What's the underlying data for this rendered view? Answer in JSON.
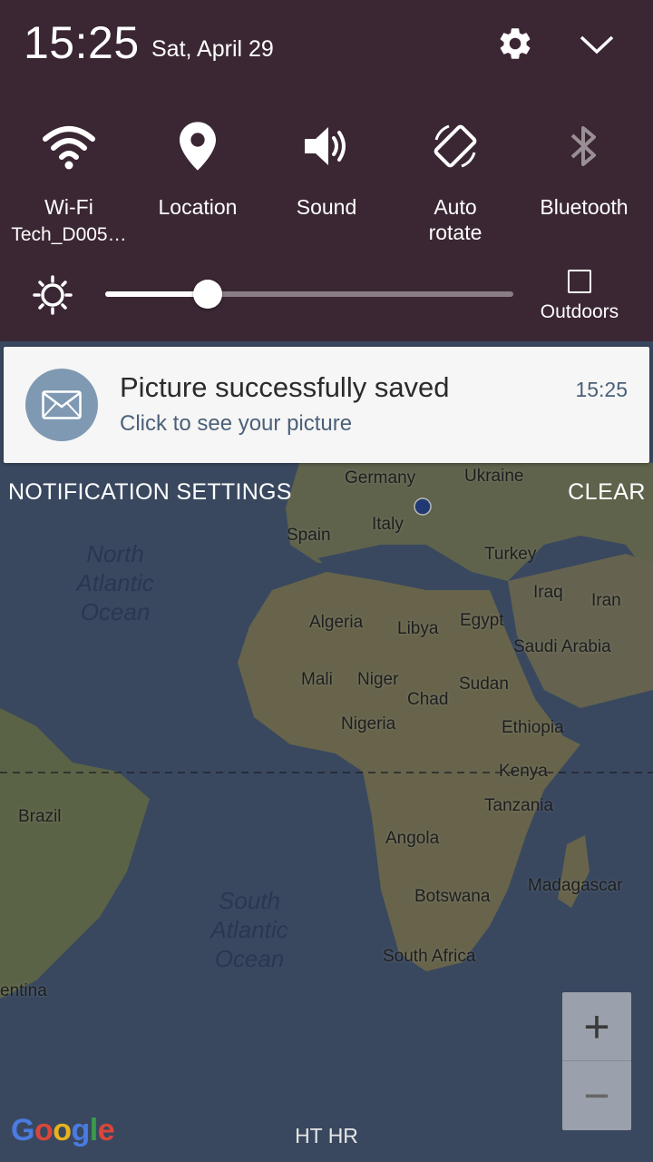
{
  "status": {
    "time": "15:25",
    "date": "Sat, April 29"
  },
  "header_icons": {
    "settings_icon": "gear-icon",
    "collapse_icon": "chevron-down-icon"
  },
  "quick_tiles": [
    {
      "label": "Wi-Fi",
      "sublabel": "Tech_D005…",
      "icon": "wifi-icon",
      "active": true
    },
    {
      "label": "Location",
      "sublabel": "",
      "icon": "location-icon",
      "active": true
    },
    {
      "label": "Sound",
      "sublabel": "",
      "icon": "speaker-icon",
      "active": true
    },
    {
      "label": "Auto\nrotate",
      "sublabel": "",
      "icon": "auto-rotate-icon",
      "active": true
    },
    {
      "label": "Bluetooth",
      "sublabel": "",
      "icon": "bluetooth-icon",
      "active": false
    }
  ],
  "brightness": {
    "level": 0.25,
    "outdoors_label": "Outdoors",
    "outdoors_checked": false
  },
  "notification": {
    "title": "Picture successfully saved",
    "text": "Click to see your picture",
    "time": "15:25",
    "icon": "mail-icon"
  },
  "actions": {
    "notification_settings": "NOTIFICATION SETTINGS",
    "clear": "CLEAR"
  },
  "map": {
    "countries": [
      "Germany",
      "Ukraine",
      "Italy",
      "Spain",
      "Turkey",
      "Iraq",
      "Iran",
      "Algeria",
      "Libya",
      "Egypt",
      "Saudi Arabia",
      "Mali",
      "Niger",
      "Chad",
      "Sudan",
      "Nigeria",
      "Ethiopia",
      "Kenya",
      "Brazil",
      "Tanzania",
      "Angola",
      "Madagascar",
      "Botswana",
      "South Africa",
      "entina"
    ],
    "oceans": [
      "North\nAtlantic\nOcean",
      "South\nAtlantic\nOcean"
    ],
    "zoom_in": "+",
    "zoom_out": "−",
    "logo": "Google",
    "carrier": "HT HR",
    "colors": {
      "ocean": "#4f6484",
      "land": "#8c8a6e"
    }
  }
}
